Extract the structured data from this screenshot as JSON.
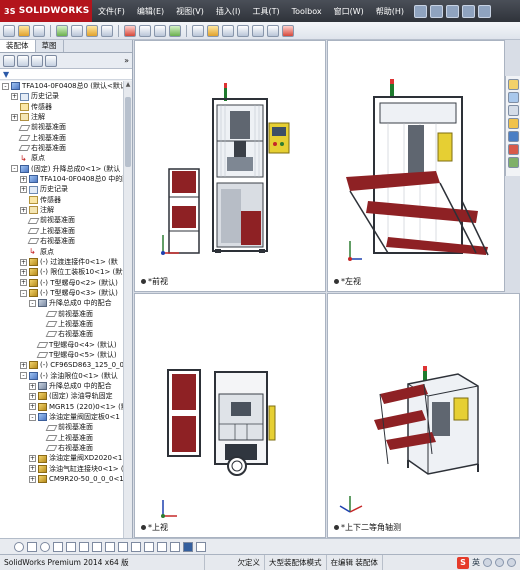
{
  "app": {
    "brand": "SOLIDWORKS",
    "brand_prefix": "3S",
    "menu": [
      "文件(F)",
      "编辑(E)",
      "视图(V)",
      "插入(I)",
      "工具(T)",
      "Toolbox",
      "窗口(W)",
      "帮助(H)"
    ]
  },
  "left_panel": {
    "tabs": [
      "装配体",
      "草图"
    ],
    "more": "»",
    "filter_icon": "funnel-icon",
    "tree": [
      {
        "indent": 0,
        "exp": "-",
        "icon": "asm",
        "text": "TFA104-0F0408总0  (默认<默认"
      },
      {
        "indent": 1,
        "exp": "+",
        "icon": "hist",
        "text": "历史记录"
      },
      {
        "indent": 1,
        "exp": "",
        "icon": "sensor",
        "text": "传感器"
      },
      {
        "indent": 1,
        "exp": "+",
        "icon": "note",
        "text": "注解"
      },
      {
        "indent": 1,
        "exp": "",
        "icon": "plane",
        "text": "前视基准面"
      },
      {
        "indent": 1,
        "exp": "",
        "icon": "plane",
        "text": "上视基准面"
      },
      {
        "indent": 1,
        "exp": "",
        "icon": "plane",
        "text": "右视基准面"
      },
      {
        "indent": 1,
        "exp": "",
        "icon": "origin",
        "text": "原点"
      },
      {
        "indent": 1,
        "exp": "-",
        "icon": "asm",
        "text": "(固定) 升降总成0<1> (默认"
      },
      {
        "indent": 2,
        "exp": "+",
        "icon": "asm",
        "text": "TFA104-0F0408总0 中的配合"
      },
      {
        "indent": 2,
        "exp": "+",
        "icon": "hist",
        "text": "历史记录"
      },
      {
        "indent": 2,
        "exp": "",
        "icon": "sensor",
        "text": "传感器"
      },
      {
        "indent": 2,
        "exp": "+",
        "icon": "note",
        "text": "注解"
      },
      {
        "indent": 2,
        "exp": "",
        "icon": "plane",
        "text": "前视基准面"
      },
      {
        "indent": 2,
        "exp": "",
        "icon": "plane",
        "text": "上视基准面"
      },
      {
        "indent": 2,
        "exp": "",
        "icon": "plane",
        "text": "右视基准面"
      },
      {
        "indent": 2,
        "exp": "",
        "icon": "origin",
        "text": "原点"
      },
      {
        "indent": 2,
        "exp": "+",
        "icon": "part",
        "text": "(-) 过渡连接件0<1> (默"
      },
      {
        "indent": 2,
        "exp": "+",
        "icon": "part",
        "text": "(-) 限位工装板10<1> (默认"
      },
      {
        "indent": 2,
        "exp": "+",
        "icon": "part",
        "text": "(-) T型螺母0<2> (默认)"
      },
      {
        "indent": 2,
        "exp": "-",
        "icon": "part",
        "text": "(-) T型螺母0<3> (默认)"
      },
      {
        "indent": 3,
        "exp": "-",
        "icon": "mate",
        "text": "升降总成0 中的配合"
      },
      {
        "indent": 4,
        "exp": "",
        "icon": "plane",
        "text": "前视基准面"
      },
      {
        "indent": 4,
        "exp": "",
        "icon": "plane",
        "text": "上视基准面"
      },
      {
        "indent": 4,
        "exp": "",
        "icon": "plane",
        "text": "右视基准面"
      },
      {
        "indent": 3,
        "exp": "",
        "icon": "plane",
        "text": "T型螺母0<4> (默认)"
      },
      {
        "indent": 3,
        "exp": "",
        "icon": "plane",
        "text": "T型螺母0<5> (默认)"
      },
      {
        "indent": 2,
        "exp": "+",
        "icon": "part",
        "text": "(-) CF96SD863_125_0_0_"
      },
      {
        "indent": 2,
        "exp": "-",
        "icon": "asm",
        "text": "(-) 涂油限位0<1> (默认"
      },
      {
        "indent": 3,
        "exp": "+",
        "icon": "mate",
        "text": "升降总成0 中的配合"
      },
      {
        "indent": 3,
        "exp": "+",
        "icon": "part",
        "text": "(固定) 涂油导轨固定"
      },
      {
        "indent": 3,
        "exp": "+",
        "icon": "part",
        "text": "MGR15 (220)0<1> (默认"
      },
      {
        "indent": 3,
        "exp": "-",
        "icon": "asm",
        "text": "涂油定量阀固定板0<1"
      },
      {
        "indent": 4,
        "exp": "",
        "icon": "plane",
        "text": "前视基准面"
      },
      {
        "indent": 4,
        "exp": "",
        "icon": "plane",
        "text": "上视基准面"
      },
      {
        "indent": 4,
        "exp": "",
        "icon": "plane",
        "text": "右视基准面"
      },
      {
        "indent": 3,
        "exp": "+",
        "icon": "part",
        "text": "涂油定量阀XD2020<1"
      },
      {
        "indent": 3,
        "exp": "+",
        "icon": "part",
        "text": "涂油气缸连接块0<1> (默"
      },
      {
        "indent": 3,
        "exp": "+",
        "icon": "part",
        "text": "CM9R20-50_0_0_0<1"
      }
    ]
  },
  "viewports": {
    "front": {
      "label": "*前视"
    },
    "left": {
      "label": "*左视"
    },
    "top": {
      "label": "*上视"
    },
    "iso": {
      "label": "*上下二等角轴测"
    }
  },
  "status": {
    "product": "SolidWorks Premium 2014 x64 版",
    "undefined": "欠定义",
    "mode": "大型装配体模式",
    "editing": "在编辑 装配体",
    "ime_logo": "S",
    "ime_lang": "英"
  },
  "colors": {
    "brand": "#b3141c",
    "frame": "#2d3138",
    "red_part": "#8e2124",
    "yellow_panel": "#e6cf33"
  }
}
